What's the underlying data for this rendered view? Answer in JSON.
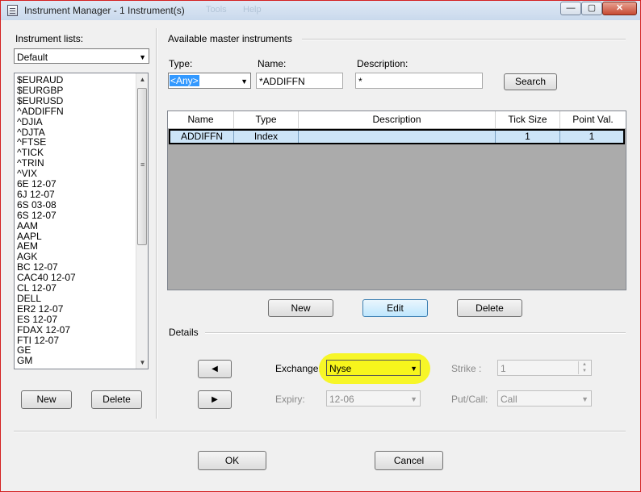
{
  "window": {
    "title": "Instrument Manager - 1 Instrument(s)",
    "ghost_menu": [
      "Tools",
      "Help"
    ],
    "controls": {
      "minimize": "—",
      "maximize": "▢",
      "close": "✕"
    }
  },
  "left_panel": {
    "lists_label": "Instrument lists:",
    "list_selector": "Default",
    "instruments": [
      "$EURAUD",
      "$EURGBP",
      "$EURUSD",
      "^ADDIFFN",
      "^DJIA",
      "^DJTA",
      "^FTSE",
      "^TICK",
      "^TRIN",
      "^VIX",
      "6E 12-07",
      "6J 12-07",
      "6S 03-08",
      "6S 12-07",
      "AAM",
      "AAPL",
      "AEM",
      "AGK",
      "BC 12-07",
      "CAC40 12-07",
      "CL 12-07",
      "DELL",
      "ER2 12-07",
      "ES 12-07",
      "FDAX 12-07",
      "FTI 12-07",
      "GE",
      "GM"
    ],
    "new_button": "New",
    "delete_button": "Delete"
  },
  "master": {
    "group_label": "Available master instruments",
    "type_label": "Type:",
    "type_value": "<Any>",
    "name_label": "Name:",
    "name_value": "*ADDIFFN",
    "description_label": "Description:",
    "description_value": "*",
    "search_button": "Search",
    "columns": [
      "Name",
      "Type",
      "Description",
      "Tick Size",
      "Point Val."
    ],
    "rows": [
      {
        "name": "ADDIFFN",
        "type": "Index",
        "description": "",
        "tick_size": "1",
        "point_val": "1"
      }
    ],
    "new_button": "New",
    "edit_button": "Edit",
    "delete_button": "Delete"
  },
  "details": {
    "group_label": "Details",
    "prev_glyph": "◀",
    "next_glyph": "▶",
    "exchange_label": "Exchange:",
    "exchange_value": "Nyse",
    "expiry_label": "Expiry:",
    "expiry_value": "12-06",
    "strike_label": "Strike :",
    "strike_value": "1",
    "putcall_label": "Put/Call:",
    "putcall_value": "Call",
    "highlight_color": "#f7f51c"
  },
  "footer": {
    "ok_button": "OK",
    "cancel_button": "Cancel"
  }
}
